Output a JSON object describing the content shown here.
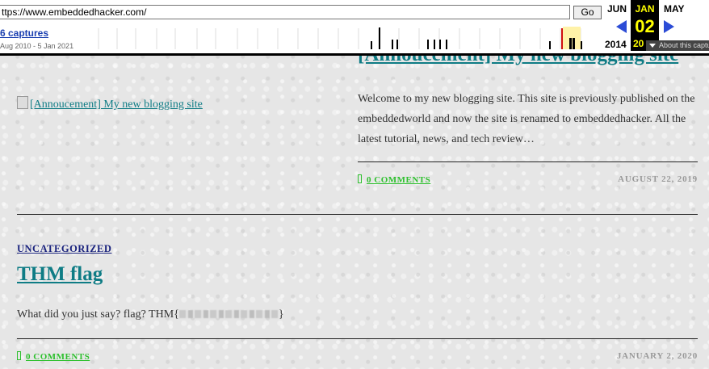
{
  "wayback": {
    "url": "ttps://www.embeddedhacker.com/",
    "go_label": "Go",
    "captures": "6 captures",
    "range": "Aug 2010 - 5 Jan 2021",
    "prev_month": "JUN",
    "current_month": "JAN",
    "next_month": "MAY",
    "current_day": "02",
    "current_year": "20",
    "prev_year": "2014",
    "about": "About this capture",
    "colors": {
      "arrow": "#2c4cd6",
      "current_bg": "#000000",
      "current_fg": "#ffff00",
      "highlight": "#fff2a8",
      "marker": "#d01010"
    }
  },
  "post1": {
    "title": "[Annoucement] My new blogging site",
    "image_alt": "[Annoucement] My new blogging site",
    "excerpt": "Welcome to my new blogging site. This site is previously published on the embeddedworld and now the site is renamed to embeddedhacker. All the latest tutorial, news, and tech review…",
    "comments": "0 COMMENTS",
    "date": "AUGUST 22, 2019"
  },
  "post2": {
    "category": "UNCATEGORIZED",
    "title": "THM flag",
    "body_prefix": "What did you just say? flag? THM{",
    "body_suffix": "}",
    "comments": "0 COMMENTS",
    "date": "JANUARY 2, 2020"
  },
  "colors": {
    "link": "#0f7c85",
    "comments": "#2ec02e",
    "category": "#1a237e",
    "date": "#999999"
  }
}
